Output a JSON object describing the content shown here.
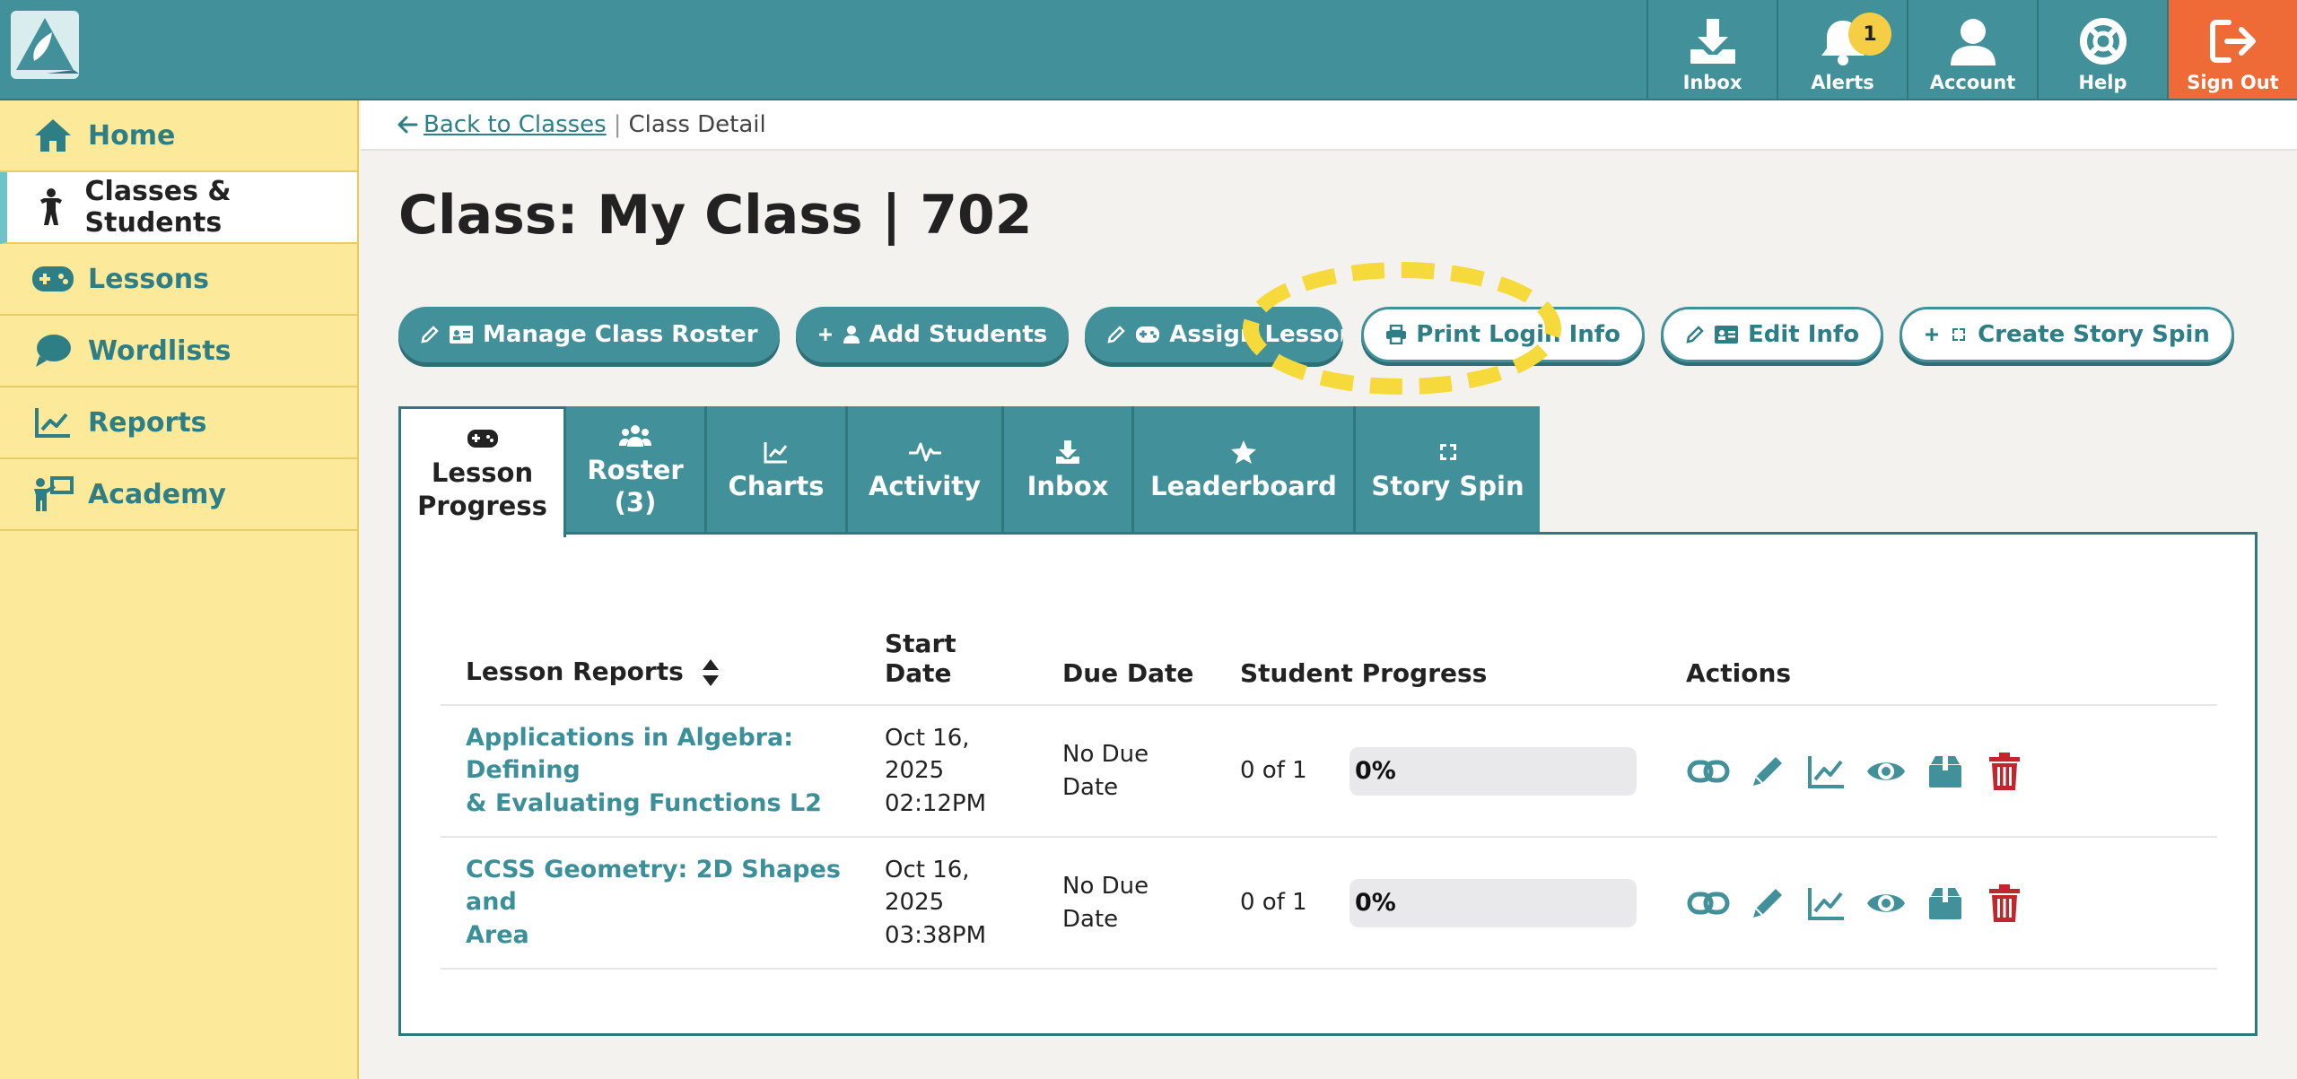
{
  "topnav": {
    "inbox": "Inbox",
    "alerts": "Alerts",
    "alerts_count": "1",
    "account": "Account",
    "help": "Help",
    "signout": "Sign Out"
  },
  "sidebar": {
    "items": [
      {
        "label": "Home",
        "icon": "home-icon"
      },
      {
        "label": "Classes & Students",
        "icon": "person-icon",
        "active": true
      },
      {
        "label": "Lessons",
        "icon": "gamepad-icon"
      },
      {
        "label": "Wordlists",
        "icon": "chat-bubble-icon"
      },
      {
        "label": "Reports",
        "icon": "chart-line-icon"
      },
      {
        "label": "Academy",
        "icon": "teacher-icon"
      }
    ]
  },
  "breadcrumb": {
    "back": "Back to Classes",
    "separator": "|",
    "current": "Class Detail"
  },
  "page_title": "Class: My Class | 702",
  "buttons": {
    "manage_roster": "Manage Class Roster",
    "add_students": "Add Students",
    "assign_lesson": "Assign Lesson",
    "print_login": "Print Login Info",
    "edit_info": "Edit Info",
    "create_story_spin": "Create Story Spin"
  },
  "tabs": {
    "lesson_progress_1": "Lesson",
    "lesson_progress_2": "Progress",
    "roster_1": "Roster",
    "roster_2": "(3)",
    "charts": "Charts",
    "activity": "Activity",
    "inbox": "Inbox",
    "leaderboard": "Leaderboard",
    "story_spin": "Story Spin"
  },
  "table": {
    "headers": {
      "lesson": "Lesson Reports",
      "start_1": "Start",
      "start_2": "Date",
      "due": "Due Date",
      "progress": "Student Progress",
      "actions": "Actions"
    },
    "rows": [
      {
        "lesson_1": "Applications in Algebra: Defining",
        "lesson_2": "& Evaluating Functions L2",
        "start_1": "Oct 16,",
        "start_2": "2025",
        "start_3": "02:12PM",
        "due_1": "No Due",
        "due_2": "Date",
        "count": "0 of 1",
        "percent": "0%",
        "fraction": 0
      },
      {
        "lesson_1": "CCSS Geometry: 2D Shapes and",
        "lesson_2": "Area",
        "start_1": "Oct 16,",
        "start_2": "2025",
        "start_3": "03:38PM",
        "due_1": "No Due",
        "due_2": "Date",
        "count": "0 of 1",
        "percent": "0%",
        "fraction": 0
      }
    ]
  },
  "colors": {
    "teal": "#42919a",
    "sidebar": "#fde99a",
    "signout": "#ee6a37",
    "delete": "#c0262c",
    "highlight": "#f6d93a"
  }
}
